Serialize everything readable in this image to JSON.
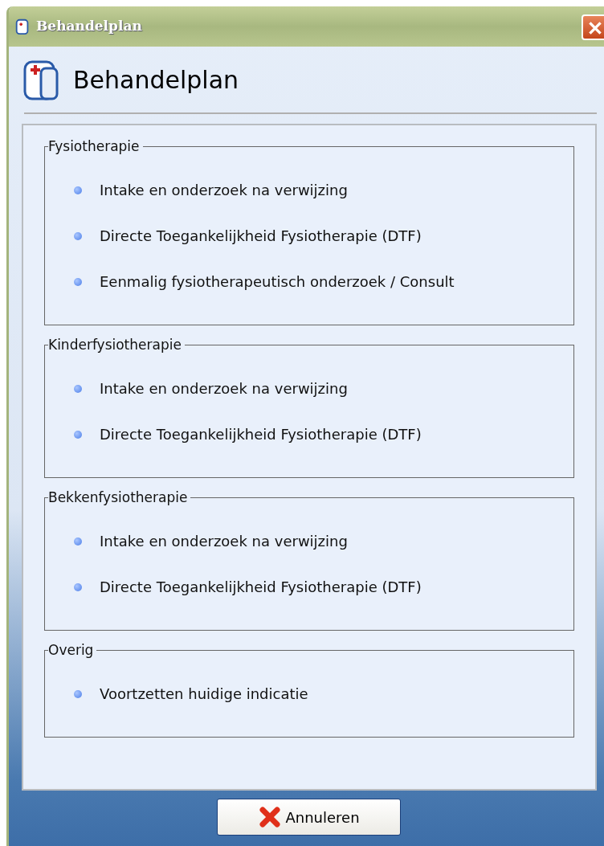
{
  "window": {
    "title": "Behandelplan"
  },
  "header": {
    "title": "Behandelplan"
  },
  "groups": [
    {
      "title": "Fysiotherapie",
      "items": [
        "Intake en onderzoek na verwijzing",
        "Directe Toegankelijkheid Fysiotherapie (DTF)",
        "Eenmalig fysiotherapeutisch onderzoek / Consult"
      ]
    },
    {
      "title": "Kinderfysiotherapie",
      "items": [
        "Intake en onderzoek na verwijzing",
        "Directe Toegankelijkheid Fysiotherapie (DTF)"
      ]
    },
    {
      "title": "Bekkenfysiotherapie",
      "items": [
        "Intake en onderzoek na verwijzing",
        "Directe Toegankelijkheid Fysiotherapie (DTF)"
      ]
    },
    {
      "title": "Overig",
      "items": [
        "Voortzetten huidige indicatie"
      ]
    }
  ],
  "buttons": [
    {
      "label": "Annuleren",
      "kind": "cancel"
    }
  ]
}
